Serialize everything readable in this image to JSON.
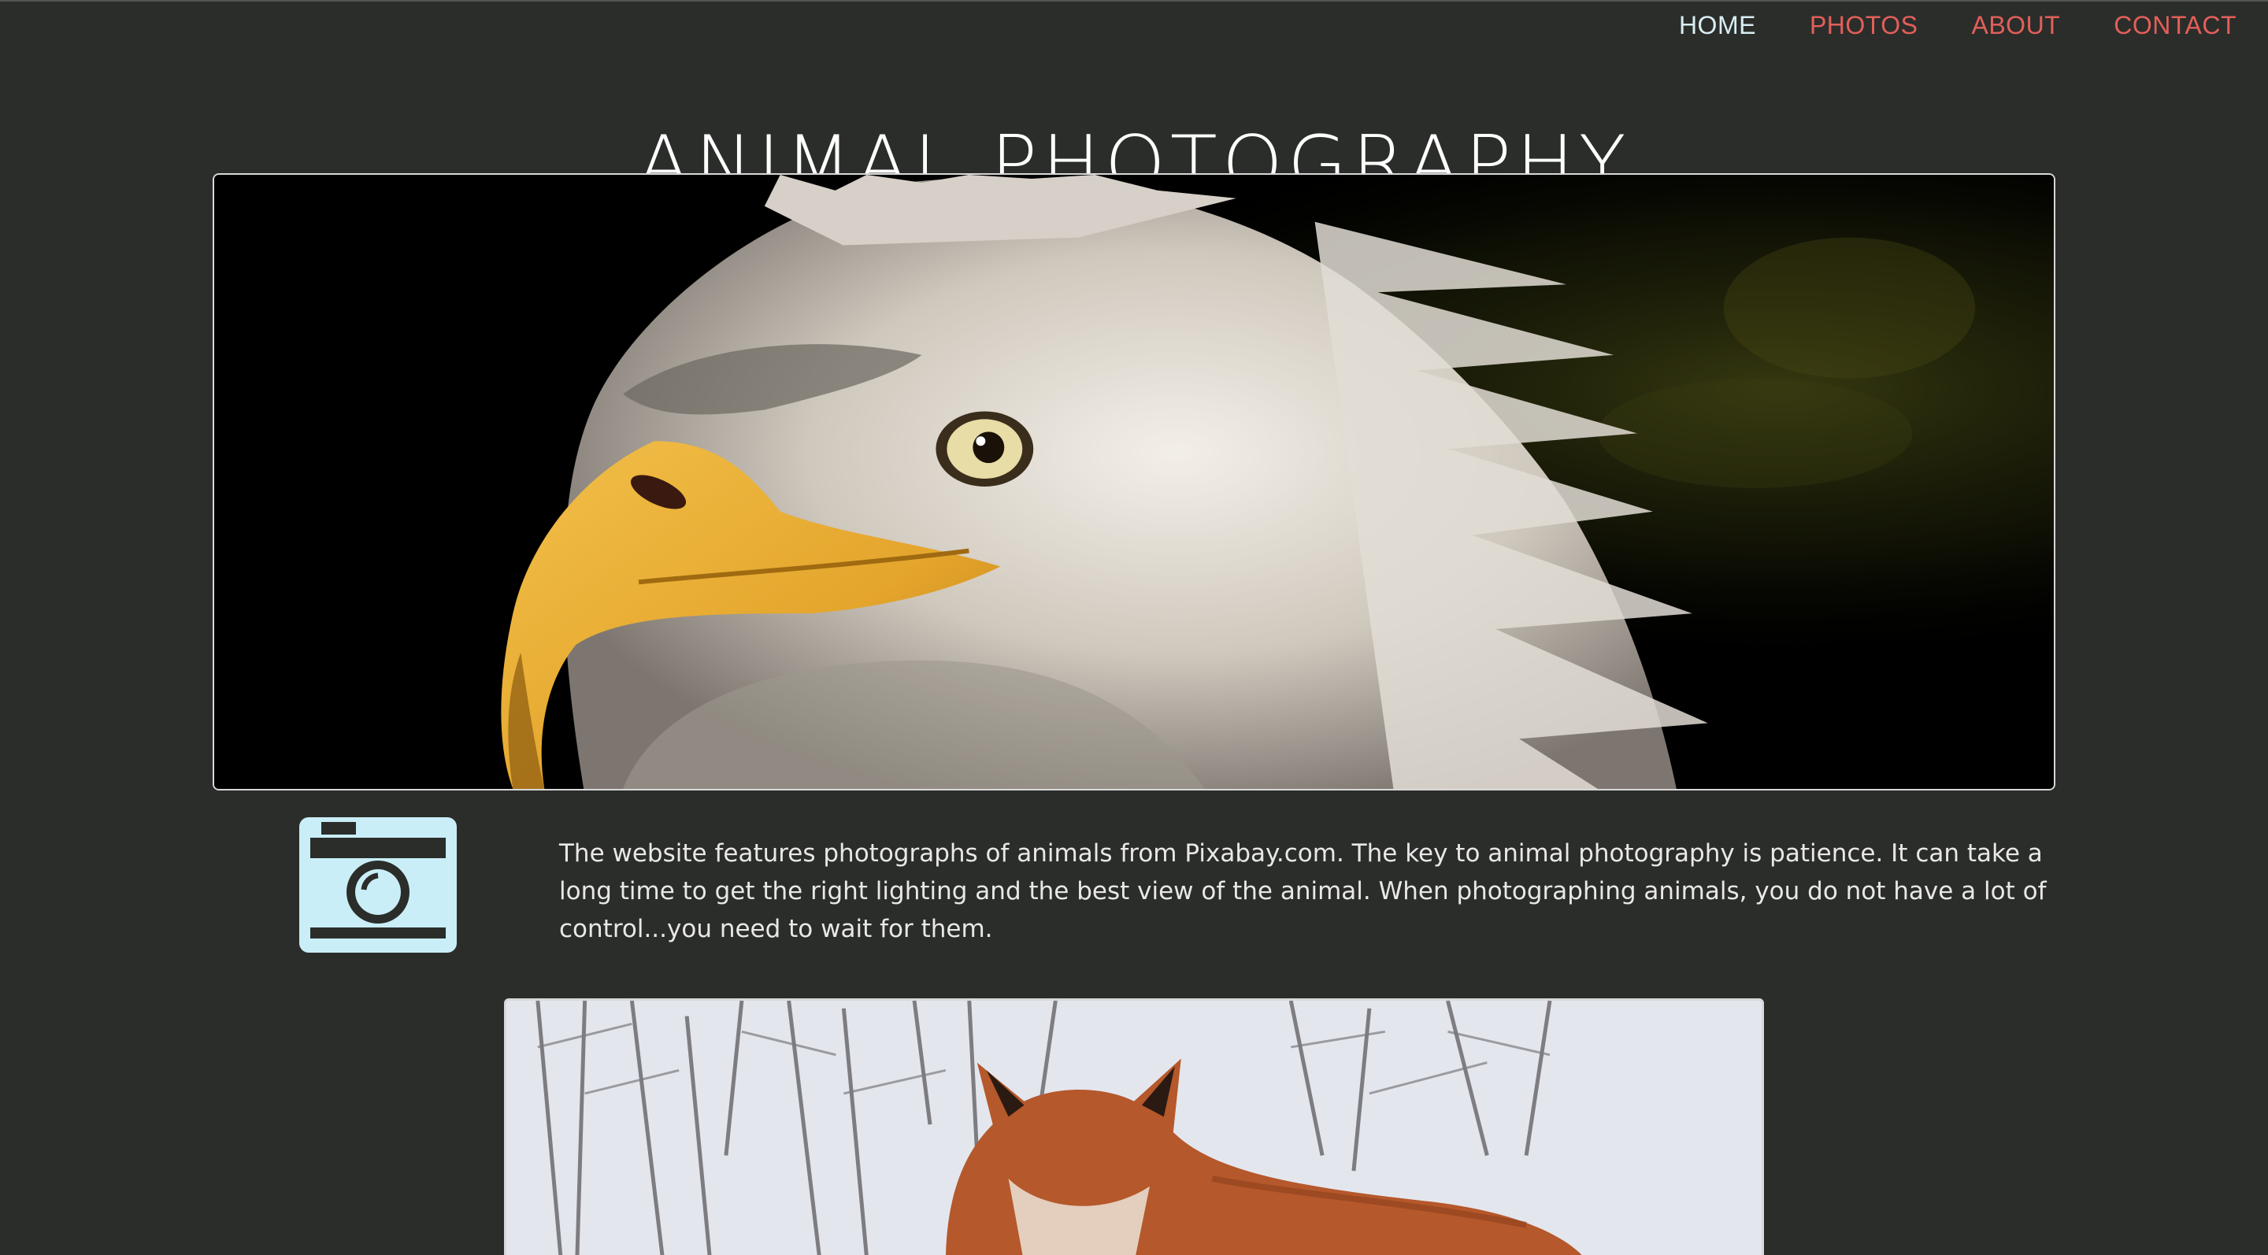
{
  "nav": {
    "items": [
      {
        "label": "HOME",
        "active": true
      },
      {
        "label": "PHOTOS",
        "active": false
      },
      {
        "label": "ABOUT",
        "active": false
      },
      {
        "label": "CONTACT",
        "active": false
      }
    ]
  },
  "header": {
    "title": "ANIMAL PHOTOGRAPHY"
  },
  "intro": {
    "icon": "camera-icon",
    "text": "The website features photographs of animals from Pixabay.com. The key to animal photography is patience. It can take a long time to get the right lighting and the best view of the animal. When photographing animals, you do not have a lot of control...you need to wait for them."
  },
  "colors": {
    "background": "#2b2d2a",
    "nav_link": "#e35f5a",
    "nav_active": "#d9eef2",
    "icon": "#c9eef7"
  }
}
